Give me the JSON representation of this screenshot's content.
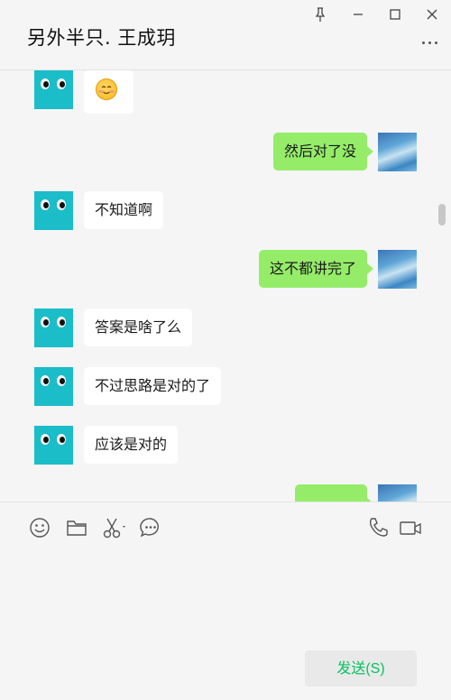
{
  "header": {
    "title": "另外半只. 王成玥",
    "window_controls": [
      "pin-icon",
      "minimize-icon",
      "maximize-icon",
      "close-icon"
    ],
    "more_icon": "more-icon"
  },
  "messages": [
    {
      "side": "incoming",
      "type": "emoji",
      "emoji": "smiling-face-icon"
    },
    {
      "side": "outgoing",
      "type": "text",
      "text": "然后对了没"
    },
    {
      "side": "incoming",
      "type": "text",
      "text": "不知道啊"
    },
    {
      "side": "outgoing",
      "type": "text",
      "text": "这不都讲完了"
    },
    {
      "side": "incoming",
      "type": "text",
      "text": "答案是啥了么"
    },
    {
      "side": "incoming",
      "type": "text",
      "text": "不过思路是对的了"
    },
    {
      "side": "incoming",
      "type": "text",
      "text": "应该是对的"
    },
    {
      "side": "outgoing",
      "type": "text",
      "text": "..."
    }
  ],
  "toolbar": {
    "left": [
      "emoji-icon",
      "folder-icon",
      "scissors-icon",
      "chat-bubble-icon"
    ],
    "right": [
      "phone-icon",
      "video-icon"
    ]
  },
  "input": {
    "value": ""
  },
  "send_button": {
    "label": "发送(S)"
  },
  "colors": {
    "outgoing_bubble": "#95ec69",
    "incoming_bubble": "#ffffff",
    "send_text": "#07c160",
    "avatar_bot": "#1bbdc9"
  }
}
